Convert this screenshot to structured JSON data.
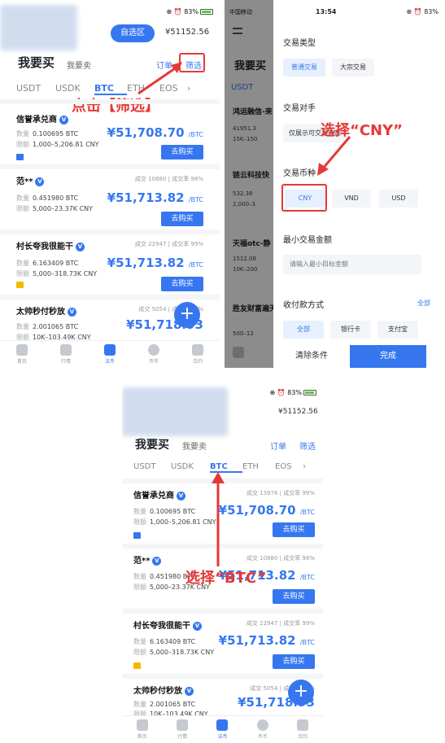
{
  "shared": {
    "status_right": "⊕ ⏰ 83%",
    "balance": "¥51152.56",
    "title": "我要买",
    "tab_sell": "我要卖",
    "orders": "订单",
    "filter": "筛选",
    "self_select": "自选区",
    "coins": [
      "USDT",
      "USDK",
      "BTC",
      "ETH",
      "EOS"
    ],
    "coins_more": "›",
    "nav": [
      "首页",
      "行情",
      "法币",
      "币币",
      "合约"
    ],
    "fab": "+",
    "buy_button": "去购买",
    "label_amount": "数量",
    "label_limit": "限额",
    "price_unit": "/BTC"
  },
  "merchants": [
    {
      "name": "信誉承兑商",
      "stats": "成交 13976 | 成交率 99%",
      "amount": "0.100695 BTC",
      "limit": "1,000–5,206.81 CNY",
      "price": "¥51,708.70",
      "pay_color": "#3677f0"
    },
    {
      "name": "范**",
      "stats": "成交 10880 | 成交率 98%",
      "amount": "0.451980 BTC",
      "limit": "5,000–23.37K CNY",
      "price": "¥51,713.82",
      "pay_color": ""
    },
    {
      "name": "村长夸我很能干",
      "stats": "成交 22947 | 成交率 99%",
      "amount": "6.163409 BTC",
      "limit": "5,000–318.73K CNY",
      "price": "¥51,713.82",
      "pay_color": "#f5b800"
    },
    {
      "name": "太帅秒付秒放",
      "stats": "成交 5054 | 成交率 97%",
      "amount": "2.001065 BTC",
      "limit": "10K–103.49K CNY",
      "price": "¥51,718.93",
      "pay_color": "#f5b800"
    }
  ],
  "panel1": {
    "annotation": "点击【筛选】"
  },
  "panel2": {
    "status_left": "中国移动",
    "status_time": "13:54",
    "section_trade_type": "交易类型",
    "trade_type_options": [
      "普通交易",
      "大宗交易"
    ],
    "section_counterparty": "交易对手",
    "counterparty_option": "仅展示可交易商家",
    "section_currency": "交易币种",
    "currency_options": [
      "CNY",
      "VND",
      "USD"
    ],
    "section_min_amount": "最小交易金额",
    "min_amount_placeholder": "请输入最小目标金额",
    "section_payment": "收付款方式",
    "payment_all_link": "全部",
    "payment_options": [
      "全部",
      "银行卡",
      "支付宝"
    ],
    "clear_button": "清除条件",
    "done_button": "完成",
    "annotation": "选择“CNY”",
    "bg_merchants": [
      "鸿运融信-来",
      "链云科技快",
      "天福otc-静",
      "胜友财富遍天"
    ],
    "bg_amounts": [
      "41951.3",
      "532.38",
      "1512.08"
    ],
    "bg_limits": [
      "15K–150",
      "2,000–3",
      "10K–200",
      "500–12"
    ]
  },
  "panel3": {
    "annotation": "选择“BTC”"
  },
  "colors": {
    "accent": "#3677f0",
    "annotation": "#e53935"
  }
}
